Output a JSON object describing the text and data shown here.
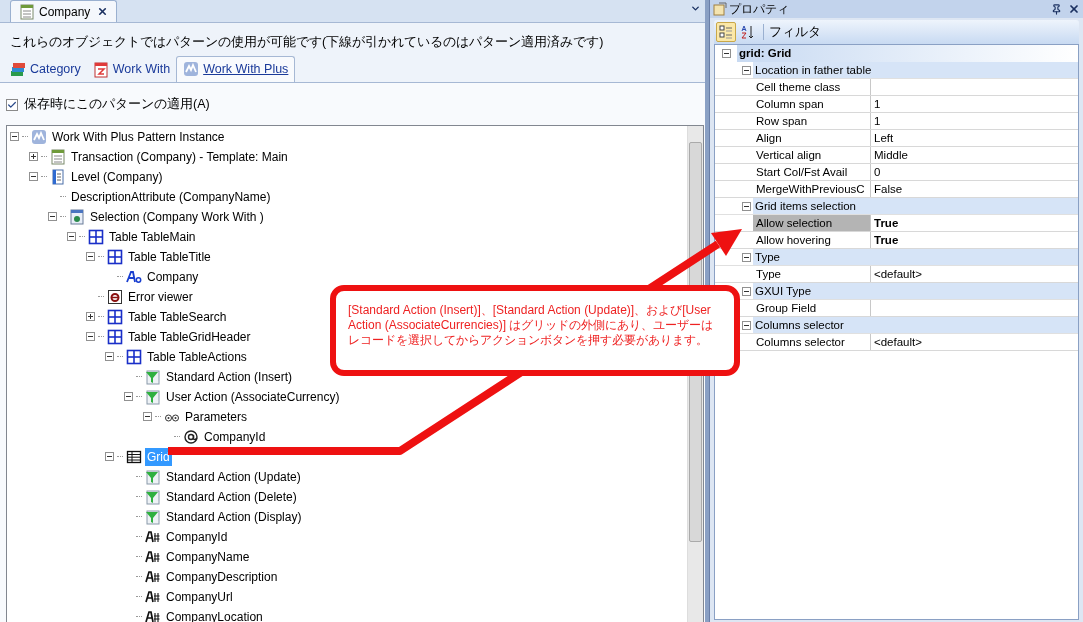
{
  "document_tab": {
    "title": "Company"
  },
  "description": "これらのオブジェクトではパターンの使用が可能です(下線が引かれているのはパターン適用済みです)",
  "pattern_tabs": [
    {
      "label": "Category",
      "kind": "category",
      "selected": false
    },
    {
      "label": "Work With",
      "kind": "workwith",
      "selected": false
    },
    {
      "label": "Work With Plus",
      "kind": "pattern",
      "selected": true
    }
  ],
  "apply_on_save": {
    "label": "保存時にこのパターンの適用(A)",
    "checked": true
  },
  "tree": [
    {
      "label": "Work With Plus Pattern Instance",
      "kind": "pattern",
      "expanded": true,
      "selected": false,
      "children": [
        {
          "label": "Transaction (Company) - Template: Main",
          "kind": "transaction",
          "expanded": false,
          "selected": false
        },
        {
          "label": "Level (Company)",
          "kind": "level",
          "expanded": true,
          "selected": false,
          "children": [
            {
              "label": "DescriptionAttribute (CompanyName)",
              "kind": "plain",
              "selected": false
            },
            {
              "label": "Selection (Company Work With )",
              "kind": "selection",
              "expanded": true,
              "selected": false,
              "children": [
                {
                  "label": "Table TableMain",
                  "kind": "table",
                  "expanded": true,
                  "selected": false,
                  "children": [
                    {
                      "label": "Table TableTitle",
                      "kind": "table",
                      "expanded": true,
                      "selected": false,
                      "children": [
                        {
                          "label": "Company",
                          "kind": "text",
                          "selected": false
                        }
                      ]
                    },
                    {
                      "label": "Error viewer",
                      "kind": "error",
                      "selected": false
                    },
                    {
                      "label": "Table TableSearch",
                      "kind": "table",
                      "expanded": false,
                      "selected": false
                    },
                    {
                      "label": "Table TableGridHeader",
                      "kind": "table",
                      "expanded": true,
                      "selected": false,
                      "children": [
                        {
                          "label": "Table TableActions",
                          "kind": "table",
                          "expanded": true,
                          "selected": false,
                          "children": [
                            {
                              "label": "Standard Action (Insert)",
                              "kind": "action",
                              "selected": false
                            },
                            {
                              "label": "User Action (AssociateCurrency)",
                              "kind": "action",
                              "expanded": true,
                              "selected": false,
                              "children": [
                                {
                                  "label": "Parameters",
                                  "kind": "parameters",
                                  "expanded": true,
                                  "selected": false,
                                  "children": [
                                    {
                                      "label": "CompanyId",
                                      "kind": "at",
                                      "selected": false
                                    }
                                  ]
                                }
                              ]
                            }
                          ]
                        },
                        {
                          "label": "Grid",
                          "kind": "grid",
                          "expanded": true,
                          "selected": true,
                          "children": [
                            {
                              "label": "Standard Action (Update)",
                              "kind": "action",
                              "selected": false
                            },
                            {
                              "label": "Standard Action (Delete)",
                              "kind": "action",
                              "selected": false
                            },
                            {
                              "label": "Standard Action (Display)",
                              "kind": "action",
                              "selected": false
                            },
                            {
                              "label": "CompanyId",
                              "kind": "attribute",
                              "selected": false
                            },
                            {
                              "label": "CompanyName",
                              "kind": "attribute",
                              "selected": false
                            },
                            {
                              "label": "CompanyDescription",
                              "kind": "attribute",
                              "selected": false
                            },
                            {
                              "label": "CompanyUrl",
                              "kind": "attribute",
                              "selected": false
                            },
                            {
                              "label": "CompanyLocation",
                              "kind": "attribute",
                              "selected": false
                            }
                          ]
                        }
                      ]
                    }
                  ]
                }
              ]
            }
          ]
        }
      ]
    }
  ],
  "properties_panel": {
    "title": "プロパティ",
    "toolbar": [
      {
        "kind": "categorized",
        "selected": true
      },
      {
        "kind": "alphabetical",
        "selected": false
      }
    ],
    "filter_label": "フィルタ",
    "object": "grid: Grid",
    "categories": [
      {
        "name": "Location in father table",
        "expanded": true,
        "rows": [
          {
            "name": "Cell theme class",
            "selected": false
          },
          {
            "name": "Column span",
            "value": "1",
            "bold": false,
            "selected": false
          },
          {
            "name": "Row span",
            "value": "1",
            "bold": false,
            "selected": false
          },
          {
            "name": "Align",
            "value": "Left",
            "bold": false,
            "selected": false
          },
          {
            "name": "Vertical align",
            "value": "Middle",
            "bold": false,
            "selected": false
          },
          {
            "name": "Start Col/Fst Avail",
            "value": "0",
            "bold": false,
            "selected": false
          },
          {
            "name": "MergeWithPreviousC",
            "value": "False",
            "bold": false,
            "selected": false
          }
        ]
      },
      {
        "name": "Grid items selection",
        "expanded": true,
        "rows": [
          {
            "name": "Allow selection",
            "value": "True",
            "bold": true,
            "selected": true
          },
          {
            "name": "Allow hovering",
            "value": "True",
            "bold": true,
            "selected": false
          }
        ]
      },
      {
        "name": "Type",
        "expanded": true,
        "rows": [
          {
            "name": "Type",
            "value": "<default>",
            "bold": false,
            "selected": false
          }
        ]
      },
      {
        "name": "GXUI Type",
        "expanded": true,
        "rows": [
          {
            "name": "Group Field",
            "selected": false
          }
        ]
      },
      {
        "name": "Columns selector",
        "expanded": true,
        "rows": [
          {
            "name": "Columns selector",
            "value": "<default>",
            "bold": false,
            "selected": false
          }
        ]
      }
    ]
  },
  "callout": {
    "text": "[Standard Action (Insert)]、[Standard Action (Update)]、および[User Action (AssociateCurrencies)] はグリッドの外側にあり、ユーザーはレコードを選択してからアクションボタンを押す必要があります。"
  }
}
